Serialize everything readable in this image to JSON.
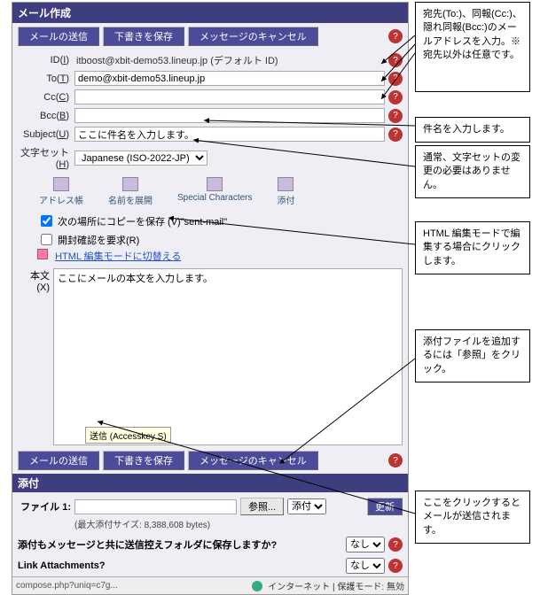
{
  "window": {
    "title": "メール作成"
  },
  "toolbar": {
    "send": "メールの送信",
    "saveDraft": "下書きを保存",
    "cancel": "メッセージのキャンセル"
  },
  "form": {
    "idLabel": "ID(",
    "idKey": "I",
    "idLabelEnd": ")",
    "idValue": "itboost@xbit-demo53.lineup.jp (デフォルト ID)",
    "toLabel": "To(",
    "toKey": "T",
    "toLabelEnd": ")",
    "toValue": "demo@xbit-demo53.lineup.jp",
    "ccLabel": "Cc(",
    "ccKey": "C",
    "ccLabelEnd": ")",
    "ccValue": "",
    "bccLabel": "Bcc(",
    "bccKey": "B",
    "bccLabelEnd": ")",
    "bccValue": "",
    "subjLabel": "Subject(",
    "subjKey": "U",
    "subjLabelEnd": ")",
    "subjValue": "ここに件名を入力します。",
    "charsetLabel": "文字セット(",
    "charsetKey": "H",
    "charsetLabelEnd": ")",
    "charsetValue": "Japanese (ISO-2022-JP)"
  },
  "iconbar": {
    "addr": "アドレス帳",
    "expand": "名前を展開",
    "special": "Special Characters",
    "attach": "添付"
  },
  "options": {
    "saveCopy": "次の場所にコピーを保存 (V)\"sent-mail\"",
    "readReceipt": "開封確認を要求(R)",
    "htmlMode": "HTML 編集モードに切替える"
  },
  "body": {
    "label": "本文(X)",
    "text": "ここにメールの本文を入力します。"
  },
  "tooltip": "送信 (Accesskey S)",
  "attach": {
    "header": "添付",
    "fileLabel": "ファイル 1:",
    "browse": "参照...",
    "dispOption": "添付",
    "update": "更新",
    "maxNote": "(最大添付サイズ: 8,388,608 bytes)",
    "saveQ": "添付もメッセージと共に送信控えフォルダに保存しますか?",
    "linkQ": "Link Attachments?",
    "optNo": "なし"
  },
  "status": {
    "url": "compose.php?uniq=c7g...",
    "zone": "インターネット | 保護モード: 無効"
  },
  "callouts": {
    "c1": "宛先(To:)、同報(Cc:)、隠れ同報(Bcc:)のメールアドレスを入力。※宛先以外は任意です。",
    "c2": "件名を入力します。",
    "c3": "通常、文字セットの変更の必要はありません。",
    "c4": "HTML 編集モードで編集する場合にクリックします。",
    "c5": "添付ファイルを追加するには「参照」をクリック。",
    "c6": "ここをクリックするとメールが送信されます。"
  }
}
